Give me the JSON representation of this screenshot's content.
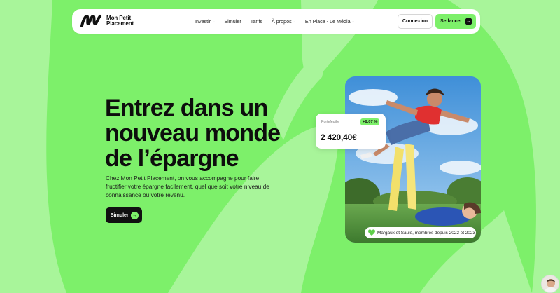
{
  "brand": {
    "name_line1": "Mon Petit",
    "name_line2": "Placement",
    "accent_color": "#7df06a"
  },
  "nav": {
    "items": [
      {
        "label": "Investir",
        "has_dropdown": true
      },
      {
        "label": "Simuler",
        "has_dropdown": false
      },
      {
        "label": "Tarifs",
        "has_dropdown": false
      },
      {
        "label": "À propos",
        "has_dropdown": true
      },
      {
        "label": "En Place - Le Média",
        "has_dropdown": true
      }
    ],
    "chevron": "⌄",
    "login_label": "Connexion",
    "cta_label": "Se lancer",
    "cta_icon": "arrow-right-icon"
  },
  "hero": {
    "title_line1": "Entrez dans un",
    "title_line2": "nouveau monde",
    "title_line3": "de l’épargne",
    "subtitle": "Chez Mon Petit Placement, on vous accompagne pour faire fructifier votre épargne facilement, quel que soit votre niveau de connaissance ou votre revenu.",
    "cta_label": "Simuler",
    "cta_icon": "arrow-right-icon"
  },
  "portfolio_card": {
    "label": "Portefeuille",
    "change_badge": "+8,07 %",
    "amount": "2 420,40€"
  },
  "photo": {
    "caption": "Margaux et Saule, membres depuis 2022 et 2023",
    "caption_icon": "green-heart-icon"
  },
  "chat": {
    "avatar_icon": "support-avatar-icon"
  }
}
